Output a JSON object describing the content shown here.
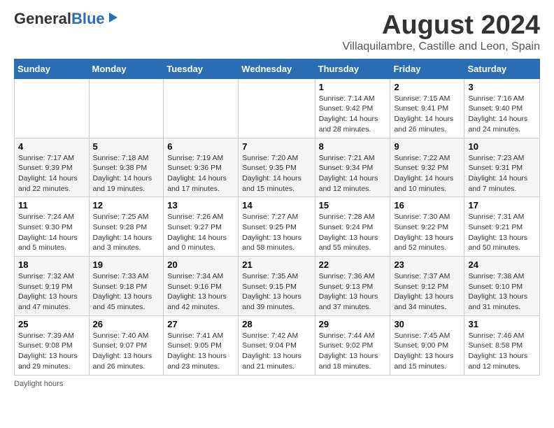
{
  "header": {
    "logo_line1": "General",
    "logo_line2": "Blue",
    "main_title": "August 2024",
    "subtitle": "Villaquilambre, Castille and Leon, Spain"
  },
  "weekdays": [
    "Sunday",
    "Monday",
    "Tuesday",
    "Wednesday",
    "Thursday",
    "Friday",
    "Saturday"
  ],
  "weeks": [
    [
      {
        "day": "",
        "info": ""
      },
      {
        "day": "",
        "info": ""
      },
      {
        "day": "",
        "info": ""
      },
      {
        "day": "",
        "info": ""
      },
      {
        "day": "1",
        "info": "Sunrise: 7:14 AM\nSunset: 9:42 PM\nDaylight: 14 hours\nand 28 minutes."
      },
      {
        "day": "2",
        "info": "Sunrise: 7:15 AM\nSunset: 9:41 PM\nDaylight: 14 hours\nand 26 minutes."
      },
      {
        "day": "3",
        "info": "Sunrise: 7:16 AM\nSunset: 9:40 PM\nDaylight: 14 hours\nand 24 minutes."
      }
    ],
    [
      {
        "day": "4",
        "info": "Sunrise: 7:17 AM\nSunset: 9:39 PM\nDaylight: 14 hours\nand 22 minutes."
      },
      {
        "day": "5",
        "info": "Sunrise: 7:18 AM\nSunset: 9:38 PM\nDaylight: 14 hours\nand 19 minutes."
      },
      {
        "day": "6",
        "info": "Sunrise: 7:19 AM\nSunset: 9:36 PM\nDaylight: 14 hours\nand 17 minutes."
      },
      {
        "day": "7",
        "info": "Sunrise: 7:20 AM\nSunset: 9:35 PM\nDaylight: 14 hours\nand 15 minutes."
      },
      {
        "day": "8",
        "info": "Sunrise: 7:21 AM\nSunset: 9:34 PM\nDaylight: 14 hours\nand 12 minutes."
      },
      {
        "day": "9",
        "info": "Sunrise: 7:22 AM\nSunset: 9:32 PM\nDaylight: 14 hours\nand 10 minutes."
      },
      {
        "day": "10",
        "info": "Sunrise: 7:23 AM\nSunset: 9:31 PM\nDaylight: 14 hours\nand 7 minutes."
      }
    ],
    [
      {
        "day": "11",
        "info": "Sunrise: 7:24 AM\nSunset: 9:30 PM\nDaylight: 14 hours\nand 5 minutes."
      },
      {
        "day": "12",
        "info": "Sunrise: 7:25 AM\nSunset: 9:28 PM\nDaylight: 14 hours\nand 3 minutes."
      },
      {
        "day": "13",
        "info": "Sunrise: 7:26 AM\nSunset: 9:27 PM\nDaylight: 14 hours\nand 0 minutes."
      },
      {
        "day": "14",
        "info": "Sunrise: 7:27 AM\nSunset: 9:25 PM\nDaylight: 13 hours\nand 58 minutes."
      },
      {
        "day": "15",
        "info": "Sunrise: 7:28 AM\nSunset: 9:24 PM\nDaylight: 13 hours\nand 55 minutes."
      },
      {
        "day": "16",
        "info": "Sunrise: 7:30 AM\nSunset: 9:22 PM\nDaylight: 13 hours\nand 52 minutes."
      },
      {
        "day": "17",
        "info": "Sunrise: 7:31 AM\nSunset: 9:21 PM\nDaylight: 13 hours\nand 50 minutes."
      }
    ],
    [
      {
        "day": "18",
        "info": "Sunrise: 7:32 AM\nSunset: 9:19 PM\nDaylight: 13 hours\nand 47 minutes."
      },
      {
        "day": "19",
        "info": "Sunrise: 7:33 AM\nSunset: 9:18 PM\nDaylight: 13 hours\nand 45 minutes."
      },
      {
        "day": "20",
        "info": "Sunrise: 7:34 AM\nSunset: 9:16 PM\nDaylight: 13 hours\nand 42 minutes."
      },
      {
        "day": "21",
        "info": "Sunrise: 7:35 AM\nSunset: 9:15 PM\nDaylight: 13 hours\nand 39 minutes."
      },
      {
        "day": "22",
        "info": "Sunrise: 7:36 AM\nSunset: 9:13 PM\nDaylight: 13 hours\nand 37 minutes."
      },
      {
        "day": "23",
        "info": "Sunrise: 7:37 AM\nSunset: 9:12 PM\nDaylight: 13 hours\nand 34 minutes."
      },
      {
        "day": "24",
        "info": "Sunrise: 7:38 AM\nSunset: 9:10 PM\nDaylight: 13 hours\nand 31 minutes."
      }
    ],
    [
      {
        "day": "25",
        "info": "Sunrise: 7:39 AM\nSunset: 9:08 PM\nDaylight: 13 hours\nand 29 minutes."
      },
      {
        "day": "26",
        "info": "Sunrise: 7:40 AM\nSunset: 9:07 PM\nDaylight: 13 hours\nand 26 minutes."
      },
      {
        "day": "27",
        "info": "Sunrise: 7:41 AM\nSunset: 9:05 PM\nDaylight: 13 hours\nand 23 minutes."
      },
      {
        "day": "28",
        "info": "Sunrise: 7:42 AM\nSunset: 9:04 PM\nDaylight: 13 hours\nand 21 minutes."
      },
      {
        "day": "29",
        "info": "Sunrise: 7:44 AM\nSunset: 9:02 PM\nDaylight: 13 hours\nand 18 minutes."
      },
      {
        "day": "30",
        "info": "Sunrise: 7:45 AM\nSunset: 9:00 PM\nDaylight: 13 hours\nand 15 minutes."
      },
      {
        "day": "31",
        "info": "Sunrise: 7:46 AM\nSunset: 8:58 PM\nDaylight: 13 hours\nand 12 minutes."
      }
    ]
  ],
  "footer": {
    "note": "Daylight hours"
  }
}
